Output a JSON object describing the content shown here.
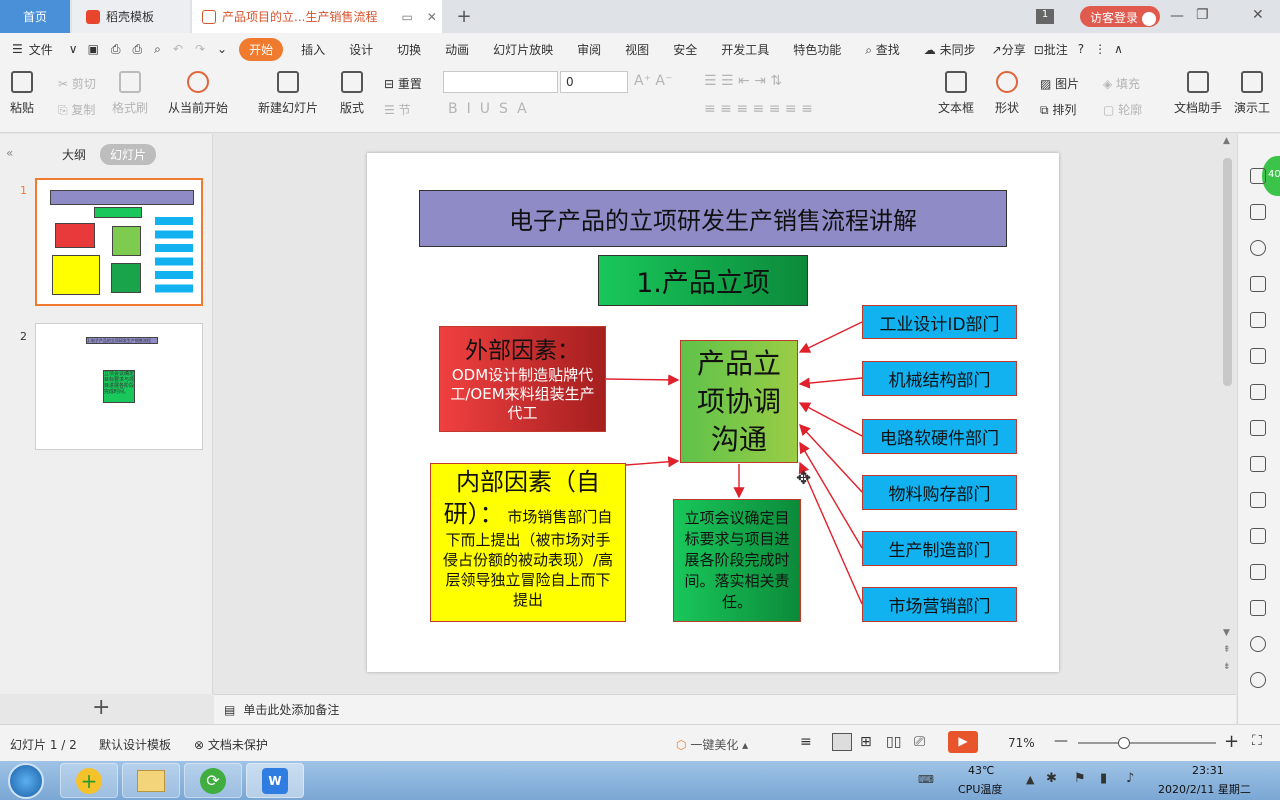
{
  "tabs": {
    "home": "首页",
    "template": "稻壳模板",
    "doc": "产品项目的立...生产销售流程",
    "page_badge": "1",
    "login": "访客登录"
  },
  "menu": {
    "file": "文件",
    "items": [
      "开始",
      "插入",
      "设计",
      "切换",
      "动画",
      "幻灯片放映",
      "审阅",
      "视图",
      "安全",
      "开发工具",
      "特色功能"
    ],
    "search": "查找",
    "sync": "未同步",
    "share": "分享",
    "comment": "批注"
  },
  "ribbon": {
    "paste": "粘贴",
    "cut": "剪切",
    "copy": "复制",
    "format_painter": "格式刷",
    "from_current": "从当前开始",
    "new_slide": "新建幻灯片",
    "layout": "版式",
    "reset": "重置",
    "section": "节",
    "font_size": "0",
    "textbox": "文本框",
    "shape": "形状",
    "picture": "图片",
    "arrange": "排列",
    "fill": "填充",
    "outline": "轮廓",
    "doc_assistant": "文档助手",
    "present": "演示工"
  },
  "panel": {
    "outline_tab": "大纲",
    "slides_tab": "幻灯片",
    "slide1_num": "1",
    "slide2_num": "2",
    "add_icon": "+"
  },
  "slide": {
    "title": "电子产品的立项研发生产销售流程讲解",
    "section": "1.产品立项",
    "external_head": "外部因素：",
    "external_body": "ODM设计制造贴牌代工/OEM来料组装生产代工",
    "internal_head": "内部因素（自研）：",
    "internal_body": "市场销售部门自下而上提出（被市场对手侵占份额的被动表现）/高层领导独立冒险自上而下提出",
    "center": "产品立项协调沟通",
    "meeting": "立项会议确定目标要求与项目进展各阶段完成时间。落实相关责任。",
    "depts": [
      "工业设计ID部门",
      "机械结构部门",
      "电路软硬件部门",
      "物料购存部门",
      "生产制造部门",
      "市场营销部门"
    ],
    "colors": {
      "title_bg": "#8e8bc7",
      "green": "#19c75b",
      "red": "#e83a3a",
      "yellow": "#ffff00",
      "blue": "#11b2ef",
      "arrow": "#e0202a"
    }
  },
  "thumb2": {
    "title": "1.电子产品的立项研发生产销售流程",
    "box": "立项会议确定目标要求与项目进展各阶段完成时间。"
  },
  "notes": {
    "placeholder": "单击此处添加备注"
  },
  "status": {
    "slide_count": "幻灯片 1 / 2",
    "template": "默认设计模板",
    "protection": "文档未保护",
    "beautify": "一键美化",
    "zoom": "71%"
  },
  "taskbar": {
    "temp": "43℃",
    "cpu": "CPU温度",
    "time": "23:31",
    "date": "2020/2/11 星期二"
  },
  "badge": "40"
}
